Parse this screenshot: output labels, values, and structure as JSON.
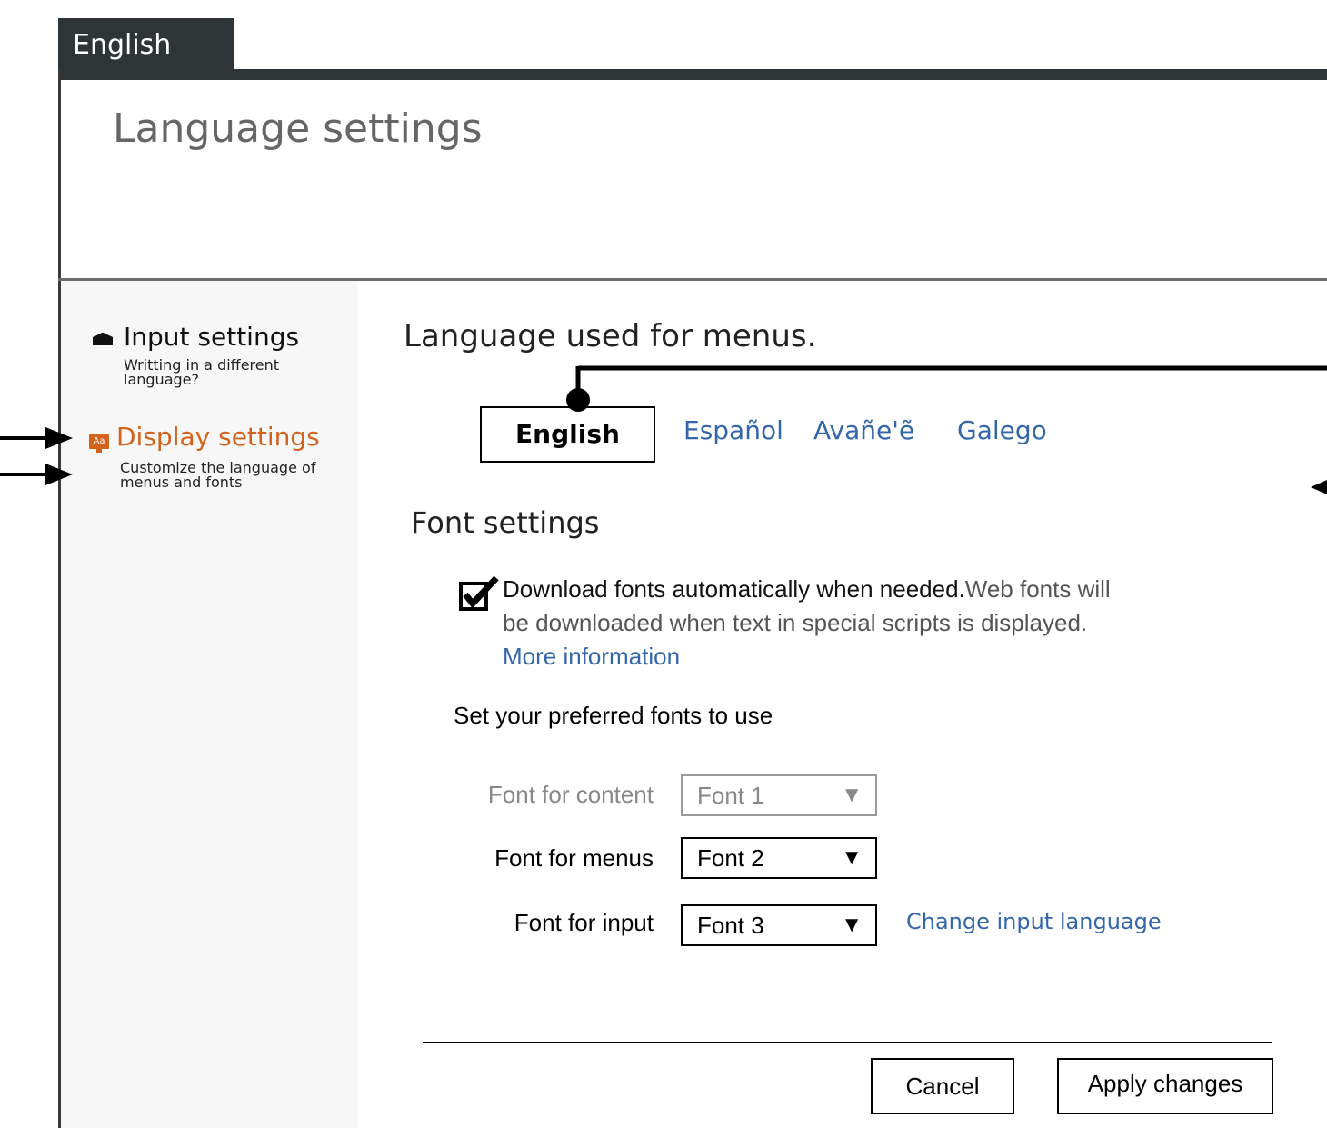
{
  "header": {
    "language_tab": "English",
    "page_title": "Language settings"
  },
  "sidebar": {
    "items": [
      {
        "label": "Input settings",
        "description": "Writting in a different language?",
        "icon": "keyboard-icon",
        "active": false
      },
      {
        "label": "Display settings",
        "description": "Customize the language of menus and fonts",
        "icon": "display-font-icon",
        "icon_text": "Aa",
        "active": true
      }
    ]
  },
  "display": {
    "menu_language_title": "Language used for menus.",
    "languages": [
      "English",
      "Español",
      "Avañe'ẽ",
      "Galego"
    ],
    "selected_language": "English"
  },
  "fonts": {
    "title": "Font settings",
    "auto_download": {
      "checked": true,
      "label": "Download fonts automatically when needed.",
      "description": "Web fonts will be downloaded when text in special scripts is displayed.",
      "link": "More information"
    },
    "preferred_label": "Set your preferred fonts to use",
    "rows": [
      {
        "label": "Font for content",
        "value": "Font 1",
        "disabled": true
      },
      {
        "label": "Font for menus",
        "value": "Font 2",
        "disabled": false
      },
      {
        "label": "Font for input",
        "value": "Font 3",
        "disabled": false
      }
    ],
    "change_input_link": "Change input language"
  },
  "footer": {
    "cancel_label": "Cancel",
    "apply_label": "Apply changes"
  },
  "icons": {
    "select_arrow": "▼"
  },
  "colors": {
    "dark_bar": "#2f3436",
    "accent_orange": "#d3621b",
    "link_blue": "#3366aa",
    "sidebar_bg": "#f7f7f7"
  }
}
